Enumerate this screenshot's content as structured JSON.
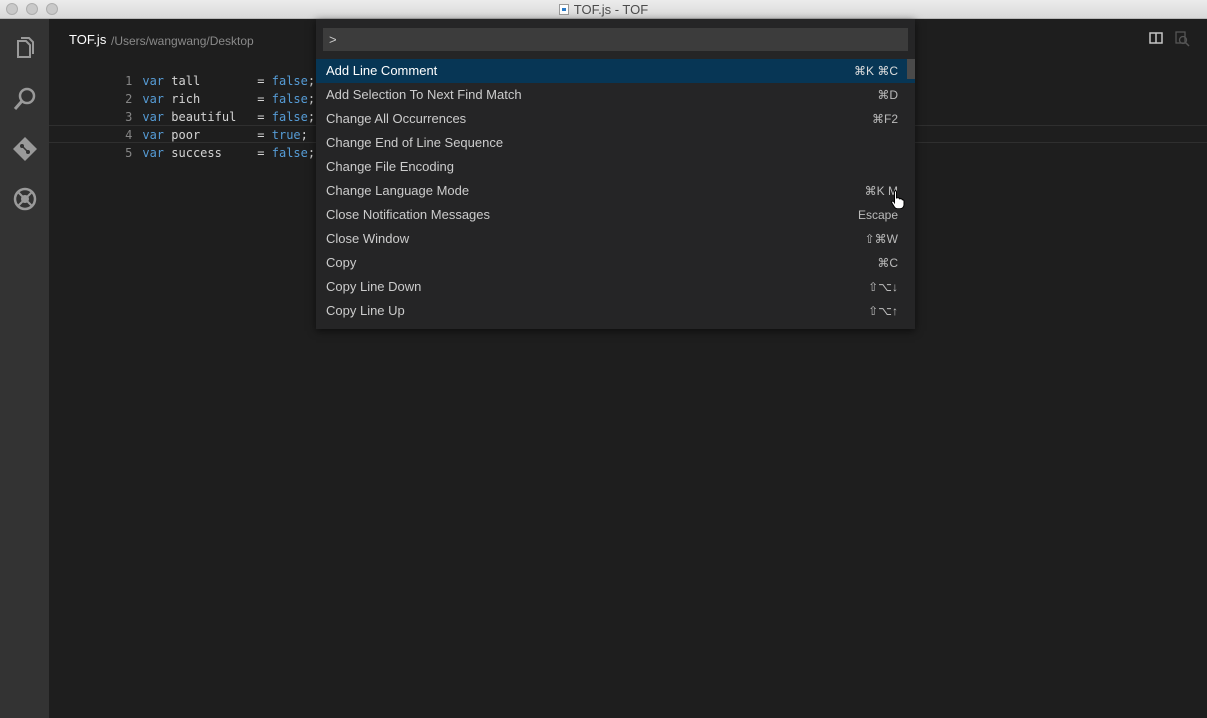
{
  "window": {
    "title": "TOF.js - TOF"
  },
  "activity_bar": {
    "icons": [
      "files-icon",
      "search-icon",
      "git-icon",
      "debug-icon"
    ]
  },
  "editor": {
    "tab_title": "TOF.js",
    "tab_path": "/Users/wangwang/Desktop",
    "lines": [
      {
        "num": "1",
        "kw": "var",
        "name": "tall",
        "op": "=",
        "value": "false",
        "end": ";"
      },
      {
        "num": "2",
        "kw": "var",
        "name": "rich",
        "op": "=",
        "value": "false",
        "end": ";"
      },
      {
        "num": "3",
        "kw": "var",
        "name": "beautiful",
        "op": "=",
        "value": "false",
        "end": ";"
      },
      {
        "num": "4",
        "kw": "var",
        "name": "poor",
        "op": "=",
        "value": "true",
        "end": ";"
      },
      {
        "num": "5",
        "kw": "var",
        "name": "success",
        "op": "=",
        "value": "false",
        "end": ";"
      }
    ]
  },
  "command_palette": {
    "input_value": ">",
    "items": [
      {
        "label": "Add Line Comment",
        "key": "⌘K ⌘C",
        "selected": true
      },
      {
        "label": "Add Selection To Next Find Match",
        "key": "⌘D"
      },
      {
        "label": "Change All Occurrences",
        "key": "⌘F2"
      },
      {
        "label": "Change End of Line Sequence",
        "key": ""
      },
      {
        "label": "Change File Encoding",
        "key": ""
      },
      {
        "label": "Change Language Mode",
        "key": "⌘K M"
      },
      {
        "label": "Close Notification Messages",
        "key": "Escape"
      },
      {
        "label": "Close Window",
        "key": "⇧⌘W"
      },
      {
        "label": "Copy",
        "key": "⌘C"
      },
      {
        "label": "Copy Line Down",
        "key": "⇧⌥↓"
      },
      {
        "label": "Copy Line Up",
        "key": "⇧⌥↑"
      }
    ]
  },
  "colors": {
    "activity_bar": "#333333",
    "editor_bg": "#1e1e1e",
    "palette_bg": "#252526",
    "selection": "#073655",
    "keyword": "#569cd6"
  }
}
